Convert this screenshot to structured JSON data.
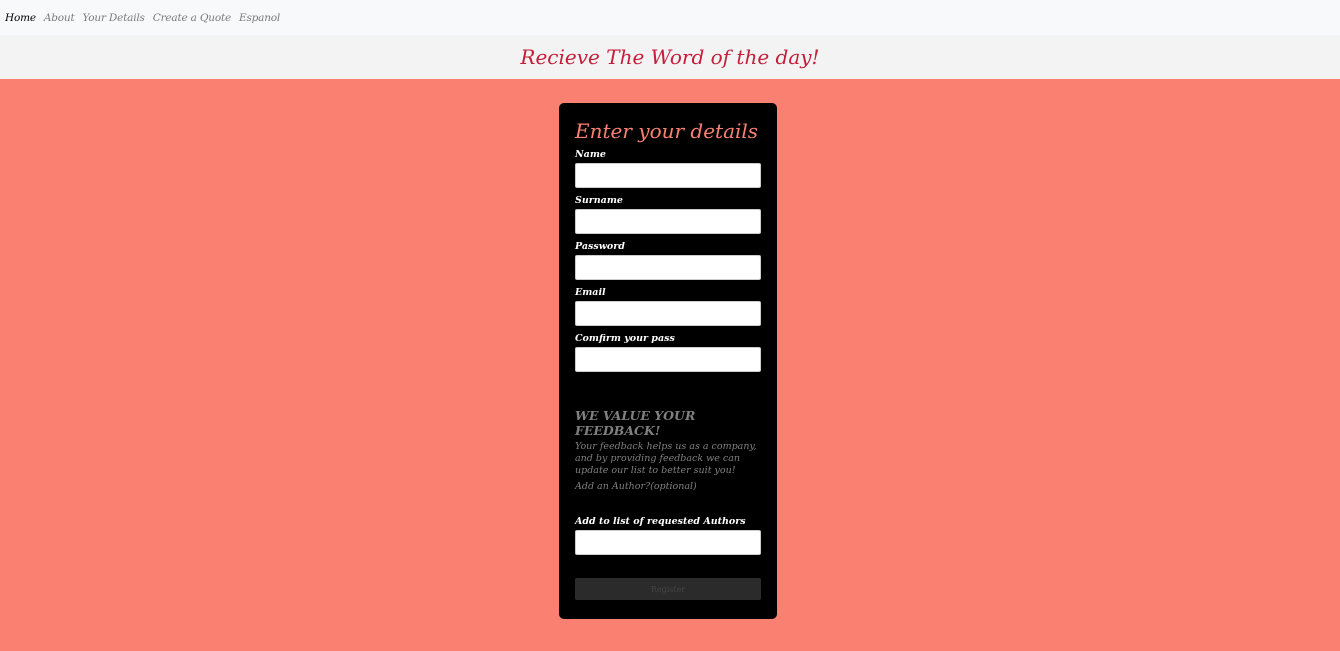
{
  "nav": {
    "items": [
      {
        "label": "Home"
      },
      {
        "label": "About"
      },
      {
        "label": "Your Details"
      },
      {
        "label": "Create a Quote"
      },
      {
        "label": "Espanol"
      }
    ]
  },
  "banner": {
    "title": "Recieve The Word of the day!"
  },
  "form": {
    "title": "Enter your details",
    "fields": {
      "name": {
        "label": "Name",
        "value": ""
      },
      "surname": {
        "label": "Surname",
        "value": ""
      },
      "password": {
        "label": "Password",
        "value": ""
      },
      "email": {
        "label": "Email",
        "value": ""
      },
      "confirm": {
        "label": "Comfirm your pass",
        "value": ""
      }
    },
    "feedback": {
      "heading": "WE VALUE YOUR FEEDBACK!",
      "text": "Your feedback helps us as a company, and by providing feedback we can update our list to better suit you!",
      "optional_note": "Add an Author?(optional)"
    },
    "authors": {
      "label": "Add to list of requested Authors",
      "value": ""
    },
    "register_label": "Register"
  },
  "colors": {
    "background": "#fa8072",
    "banner_text": "#c41e3a",
    "card": "#000000"
  }
}
